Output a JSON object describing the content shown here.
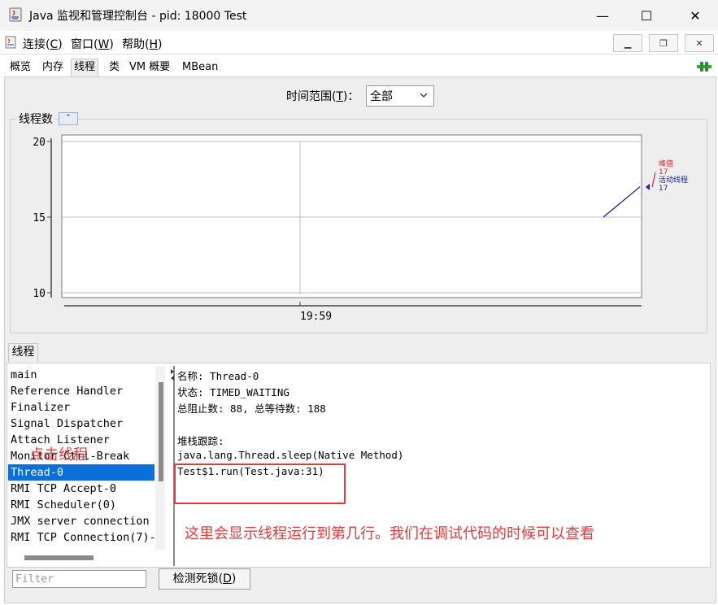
{
  "window": {
    "title": "Java 监视和管理控制台 - pid: 18000 Test",
    "minimize_glyph": "—",
    "maximize_glyph": "☐",
    "close_glyph": "✕"
  },
  "menubar": {
    "items": [
      {
        "label": "连接(",
        "mnemonic": "C",
        "suffix": ")"
      },
      {
        "label": "窗口(",
        "mnemonic": "W",
        "suffix": ")"
      },
      {
        "label": "帮助(",
        "mnemonic": "H",
        "suffix": ")"
      }
    ],
    "mdi_minimize": "▁",
    "mdi_restore": "❐",
    "mdi_close": "✕"
  },
  "tabs": [
    {
      "label": "概览"
    },
    {
      "label": "内存"
    },
    {
      "label": "线程",
      "active": true
    },
    {
      "label": "类"
    },
    {
      "label": "VM 概要"
    },
    {
      "label": "MBean"
    }
  ],
  "time_range": {
    "label": "时间范围(",
    "mnemonic": "T",
    "suffix": ")：",
    "selected": "全部"
  },
  "chart_panel": {
    "title": "线程数",
    "collapse_glyph": "⌃"
  },
  "chart_data": {
    "type": "line",
    "title": "线程数",
    "ylim": [
      10,
      20
    ],
    "y_ticks": [
      "20",
      "15",
      "10"
    ],
    "x_ticks": [
      "19:59"
    ],
    "grid": true,
    "series": [
      {
        "name": "峰值",
        "color": "#d62b2b",
        "last_value": "17"
      },
      {
        "name": "活动线程",
        "color": "#1f1f9e",
        "last_value": "17",
        "values": [
          15,
          17
        ]
      }
    ],
    "legend_position": "right"
  },
  "threads_tab": {
    "label": "线程"
  },
  "thread_list": {
    "items": [
      "main",
      "Reference Handler",
      "Finalizer",
      "Signal Dispatcher",
      "Attach Listener",
      "Monitor Ctrl-Break",
      "Thread-0",
      "RMI TCP Accept-0",
      "RMI Scheduler(0)",
      "JMX server connection",
      "RMI TCP Connection(7)-"
    ],
    "selected_index": 6
  },
  "detail": {
    "lines": [
      "名称: Thread-0",
      "状态: TIMED_WAITING",
      "总阻止数: 88, 总等待数: 188",
      "",
      "堆栈跟踪:",
      "java.lang.Thread.sleep(Native Method)",
      "Test$1.run(Test.java:31)"
    ]
  },
  "annotations": {
    "click_thread": "点击线程",
    "explanation": "这里会显示线程运行到第几行。我们在调试代码的时候可以查看"
  },
  "bottom": {
    "filter_placeholder": "Filter",
    "detect_label": "检测死锁(",
    "detect_mnemonic": "D",
    "detect_suffix": ")"
  },
  "colors": {
    "selection": "#0a6fd8",
    "annotation": "#e53b3b",
    "peak": "#d62b2b",
    "live": "#1f1f9e"
  }
}
